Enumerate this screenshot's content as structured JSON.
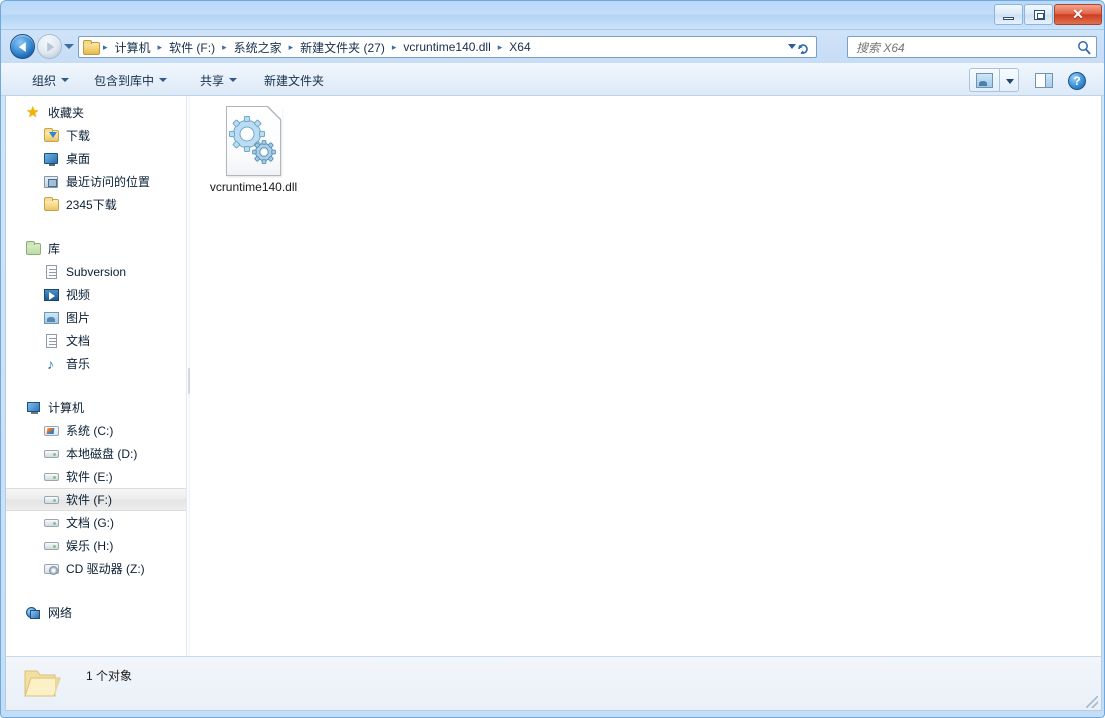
{
  "window": {
    "title": "",
    "controls": {
      "minimize": "最小化",
      "maximize": "最大化",
      "close": "✕"
    }
  },
  "navigation": {
    "back_label": "后退",
    "forward_label": "前进",
    "recent_pages_label": "最近浏览的页面",
    "address": {
      "dropdown_label": "以前的位置",
      "refresh_label": "刷新",
      "breadcrumbs": [
        {
          "label": "计算机"
        },
        {
          "label": "软件 (F:)"
        },
        {
          "label": "系统之家"
        },
        {
          "label": "新建文件夹 (27)"
        },
        {
          "label": "vcruntime140.dll"
        },
        {
          "label": "X64"
        }
      ],
      "separator": "▸"
    },
    "search": {
      "value": "",
      "placeholder": "搜索 X64",
      "icon": "search-icon"
    }
  },
  "toolbar": {
    "items": [
      {
        "label": "组织",
        "has_caret": true
      },
      {
        "label": "包含到库中",
        "has_caret": true
      },
      {
        "label": "共享",
        "has_caret": true
      },
      {
        "label": "新建文件夹",
        "has_caret": false
      }
    ],
    "views_label": "更改您的视图",
    "preview_label": "显示预览窗格",
    "help_label": "?"
  },
  "sidebar": {
    "groups": [
      {
        "header": {
          "label": "收藏夹",
          "icon": "star-icon"
        },
        "items": [
          {
            "label": "下载",
            "icon": "folder-download-icon"
          },
          {
            "label": "桌面",
            "icon": "desktop-icon"
          },
          {
            "label": "最近访问的位置",
            "icon": "recent-places-icon"
          },
          {
            "label": "2345下载",
            "icon": "folder-icon"
          }
        ]
      },
      {
        "header": {
          "label": "库",
          "icon": "library-icon"
        },
        "items": [
          {
            "label": "Subversion",
            "icon": "document-icon"
          },
          {
            "label": "视频",
            "icon": "video-icon"
          },
          {
            "label": "图片",
            "icon": "picture-icon"
          },
          {
            "label": "文档",
            "icon": "document-icon"
          },
          {
            "label": "音乐",
            "icon": "music-icon"
          }
        ]
      },
      {
        "header": {
          "label": "计算机",
          "icon": "computer-icon"
        },
        "items": [
          {
            "label": "系统 (C:)",
            "icon": "system-drive-icon",
            "selected": false
          },
          {
            "label": "本地磁盘 (D:)",
            "icon": "drive-icon",
            "selected": false
          },
          {
            "label": "软件 (E:)",
            "icon": "drive-icon",
            "selected": false
          },
          {
            "label": "软件 (F:)",
            "icon": "drive-icon",
            "selected": true
          },
          {
            "label": "文档 (G:)",
            "icon": "drive-icon",
            "selected": false
          },
          {
            "label": "娱乐 (H:)",
            "icon": "drive-icon",
            "selected": false
          },
          {
            "label": "CD 驱动器 (Z:)",
            "icon": "cd-drive-icon",
            "selected": false
          }
        ]
      },
      {
        "header": {
          "label": "网络",
          "icon": "network-icon"
        },
        "items": []
      }
    ]
  },
  "content": {
    "files": [
      {
        "name": "vcruntime140.dll",
        "icon": "dll-gear-icon",
        "selected": false
      }
    ]
  },
  "statusbar": {
    "icon": "folder-icon",
    "text": "1 个对象"
  },
  "colors": {
    "titlebar": "#c3ddf9",
    "close_button": "#cf3d21",
    "accent": "#2f6aa8",
    "selection": "#ececec"
  }
}
